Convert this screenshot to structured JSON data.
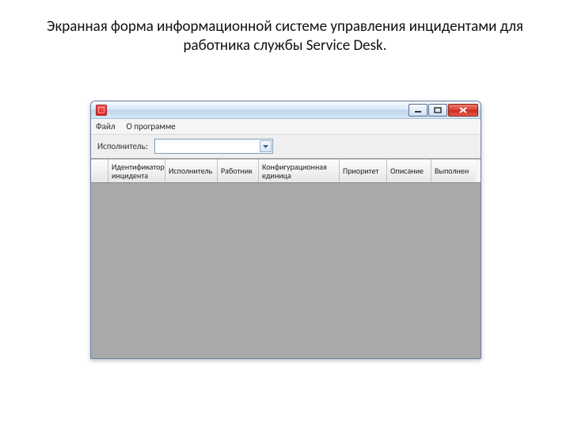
{
  "slide": {
    "title": "Экранная форма  информационной  системе управления инцидентами для работника службы Service Desk."
  },
  "window": {
    "menu": {
      "file": "Файл",
      "about": "О программе"
    },
    "filter": {
      "label": "Исполнитель:",
      "value": ""
    },
    "grid": {
      "columns": [
        "Идентификатор инцидента",
        "Исполнитель",
        "Работник",
        "Конфигурационная единица",
        "Приоритет",
        "Описание",
        "Выполнен"
      ]
    }
  }
}
